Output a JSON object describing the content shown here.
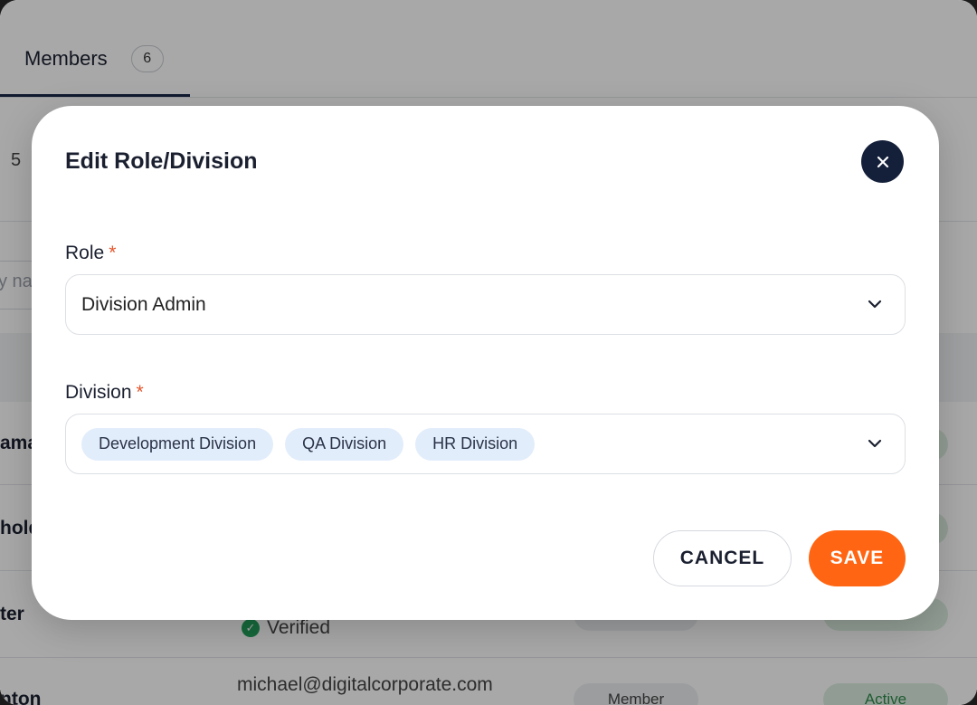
{
  "background": {
    "tab_members_label": "Members",
    "tab_members_count": "6",
    "side_number": "5",
    "search_fragment": "y na",
    "rows": [
      {
        "name_fragment": "ama"
      },
      {
        "name_fragment": "hold"
      },
      {
        "name_fragment": "ter"
      },
      {
        "name_fragment": "nton"
      }
    ],
    "verified_label": "Verified",
    "email": "michael@digitalcorporate.com",
    "role_pill": "Member",
    "status_pill": "Active"
  },
  "modal": {
    "title": "Edit Role/Division",
    "role_label": "Role",
    "role_value": "Division Admin",
    "division_label": "Division",
    "required_mark": "*",
    "divisions": [
      "Development Division",
      "QA Division",
      "HR Division"
    ],
    "cancel_label": "CANCEL",
    "save_label": "SAVE"
  },
  "colors": {
    "primary_dark": "#14203a",
    "accent_orange": "#ff6512",
    "chip_bg": "#e2edfb",
    "required_red": "#e4572e"
  }
}
